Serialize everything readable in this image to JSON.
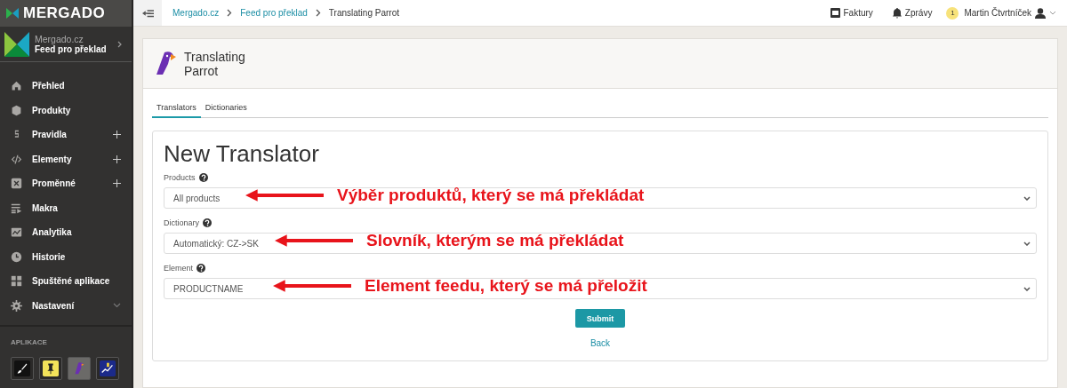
{
  "brand": "MERGADO",
  "project": {
    "name": "Mergado.cz",
    "feed": "Feed pro překlad"
  },
  "nav": [
    {
      "label": "Přehled",
      "kind": "plain"
    },
    {
      "label": "Produkty",
      "kind": "plain"
    },
    {
      "label": "Pravidla",
      "kind": "addable"
    },
    {
      "label": "Elementy",
      "kind": "addable"
    },
    {
      "label": "Proměnné",
      "kind": "addable"
    },
    {
      "label": "Makra",
      "kind": "plain"
    },
    {
      "label": "Analytika",
      "kind": "plain"
    },
    {
      "label": "Historie",
      "kind": "plain"
    },
    {
      "label": "Spuštěné aplikace",
      "kind": "plain"
    },
    {
      "label": "Nastavení",
      "kind": "collapsible"
    }
  ],
  "apps_heading": "APLIKACE",
  "apps": [
    {
      "selected": false
    },
    {
      "selected": false
    },
    {
      "selected": true
    },
    {
      "selected": false
    }
  ],
  "breadcrumbs": [
    "Mergado.cz",
    "Feed pro překlad",
    "Translating Parrot"
  ],
  "topbar": {
    "invoices": "Faktury",
    "messages": "Zprávy",
    "badge": "1",
    "user": "Martin Čtvrtníček"
  },
  "app_title": "Translating Parrot",
  "tabs": [
    {
      "label": "Translators",
      "selected": true
    },
    {
      "label": "Dictionaries",
      "selected": false
    }
  ],
  "form": {
    "title": "New Translator",
    "fields": [
      {
        "label": "Products",
        "value": "All products",
        "annotation": "Výběr produktů, který se má překládat"
      },
      {
        "label": "Dictionary",
        "value": "Automatický: CZ->SK",
        "annotation": "Slovník, kterým se má překládat"
      },
      {
        "label": "Element",
        "value": "PRODUCTNAME",
        "annotation": "Element feedu, který se má přeložit"
      }
    ],
    "submit": "Submit",
    "back": "Back"
  }
}
